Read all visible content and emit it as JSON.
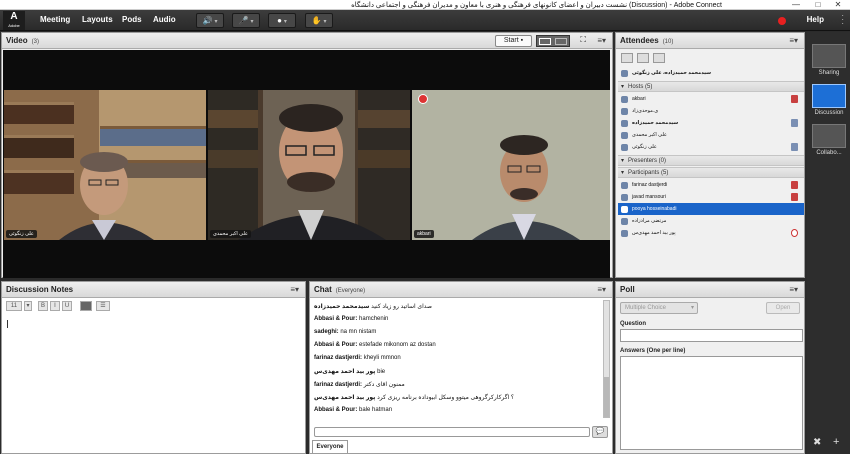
{
  "window": {
    "title": "نشست دبیران و اعضای کانونهای فرهنگی و هنری با معاون و مدیران فرهنگی و اجتماعی دانشگاه (Discussion) - Adobe Connect",
    "min_label": "—",
    "max_label": "□",
    "close_label": "✕"
  },
  "menubar": {
    "logo_letter": "A",
    "logo_text": "Adobe",
    "items": [
      "Meeting",
      "Layouts",
      "Pods",
      "Audio"
    ],
    "help": "Help"
  },
  "video": {
    "title": "Video",
    "count": "(3)",
    "start_label": "Start",
    "cameras": [
      {
        "label": "علی زنگوئی"
      },
      {
        "label": "علی اکبر محمدی"
      },
      {
        "label": "akbari"
      }
    ]
  },
  "layouts": {
    "items": [
      {
        "label": "Sharing"
      },
      {
        "label": "Discussion"
      },
      {
        "label": "Collabo..."
      }
    ]
  },
  "attendees": {
    "title": "Attendees",
    "count": "(10)",
    "presenter_banner": "سیدمحمد حمیدزاده، علی زنگوئی",
    "hosts": {
      "label": "Hosts (5)",
      "people": [
        "akbari",
        "ی.موحدی‌زاد",
        "سیدمحمد حمیدزاده",
        "علی اکبر محمدی",
        "علی زنگوئی"
      ]
    },
    "presenters": {
      "label": "Presenters (0)"
    },
    "participants": {
      "label": "Participants (5)",
      "people": [
        "farinaz dastjerdi",
        "javad mansouri",
        "pooya hosseinabadi",
        "مرتضی مرادزاده",
        "پور بید احمد مهدی‌س"
      ]
    }
  },
  "notes": {
    "title": "Discussion Notes",
    "font_size": "11",
    "tools": [
      "B",
      "I",
      "U"
    ]
  },
  "chat": {
    "title": "Chat",
    "scope": "(Everyone)",
    "tab": "Everyone",
    "send_icon": "💬",
    "messages": [
      {
        "sender": "سیدمحمد حمیدزاده",
        "text": "صدای اساتید رو زیاد کنید"
      },
      {
        "sender": "Abbasi & Pour:",
        "text": "hamchenin"
      },
      {
        "sender": "sadeghi:",
        "text": "na mn nistam"
      },
      {
        "sender": "Abbasi & Pour:",
        "text": "estefade mikonom az dostan"
      },
      {
        "sender": "farinaz dastjerdi:",
        "text": "kheyli mmnon"
      },
      {
        "sender": "پور بید احمد مهدی‌س",
        "text": "bie"
      },
      {
        "sender": "farinaz dastjerdi:",
        "text": "ممنون اقای دکتر"
      },
      {
        "sender": "پور بید احمد مهدی‌س",
        "text": "؟ اگرکارکرگروهی میتوو وسکل ابیوداده برنامه ریزی کرد"
      },
      {
        "sender": "Abbasi & Pour:",
        "text": "bale hatman"
      }
    ]
  },
  "poll": {
    "title": "Poll",
    "type_select": "Multiple Choice",
    "open_label": "Open",
    "question_label": "Question",
    "answers_label": "Answers (One per line)"
  },
  "colors": {
    "accent": "#1a64c9",
    "record": "#e82020"
  }
}
